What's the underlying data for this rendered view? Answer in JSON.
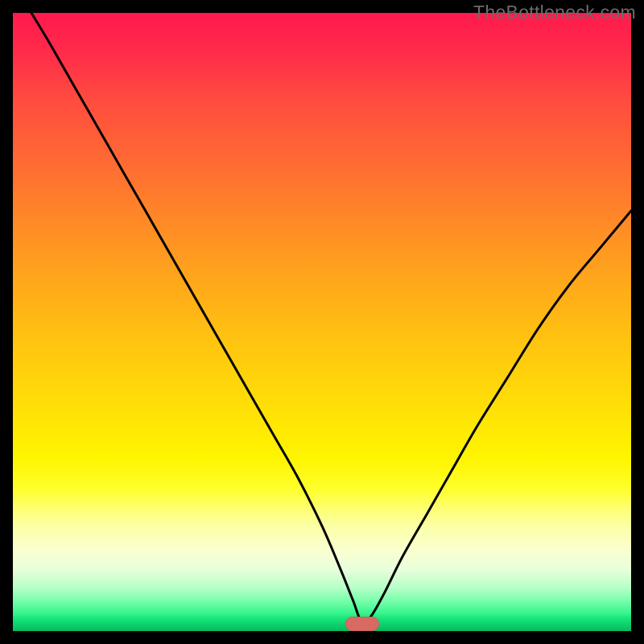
{
  "watermark": "TheBottleneck.com",
  "marker": {
    "color": "#d86a63",
    "x_pct": 56.5,
    "y_pct": 98.8
  },
  "chart_data": {
    "type": "line",
    "title": "",
    "xlabel": "",
    "ylabel": "",
    "xlim": [
      0,
      100
    ],
    "ylim": [
      0,
      100
    ],
    "grid": false,
    "legend": false,
    "note": "Axes are unlabeled; values estimated from pixel positions as percentages of plot area. y=0 at bottom, y=100 at top.",
    "series": [
      {
        "name": "curve",
        "x": [
          3.0,
          6.0,
          10.0,
          14.0,
          18.0,
          22.0,
          26.0,
          30.0,
          34.0,
          38.0,
          42.0,
          46.0,
          50.0,
          53.0,
          55.0,
          56.5,
          58.0,
          60.0,
          63.0,
          67.0,
          71.0,
          75.0,
          80.0,
          85.0,
          90.0,
          95.0,
          100.0
        ],
        "y": [
          100.0,
          95.0,
          88.0,
          81.0,
          74.0,
          67.0,
          60.0,
          53.0,
          46.0,
          39.0,
          32.0,
          25.0,
          17.0,
          10.0,
          5.0,
          1.3,
          2.5,
          6.0,
          12.0,
          19.0,
          26.0,
          33.0,
          41.0,
          49.0,
          56.0,
          62.0,
          68.0
        ]
      }
    ],
    "minimum_marker": {
      "x": 56.5,
      "y": 1.3
    }
  }
}
